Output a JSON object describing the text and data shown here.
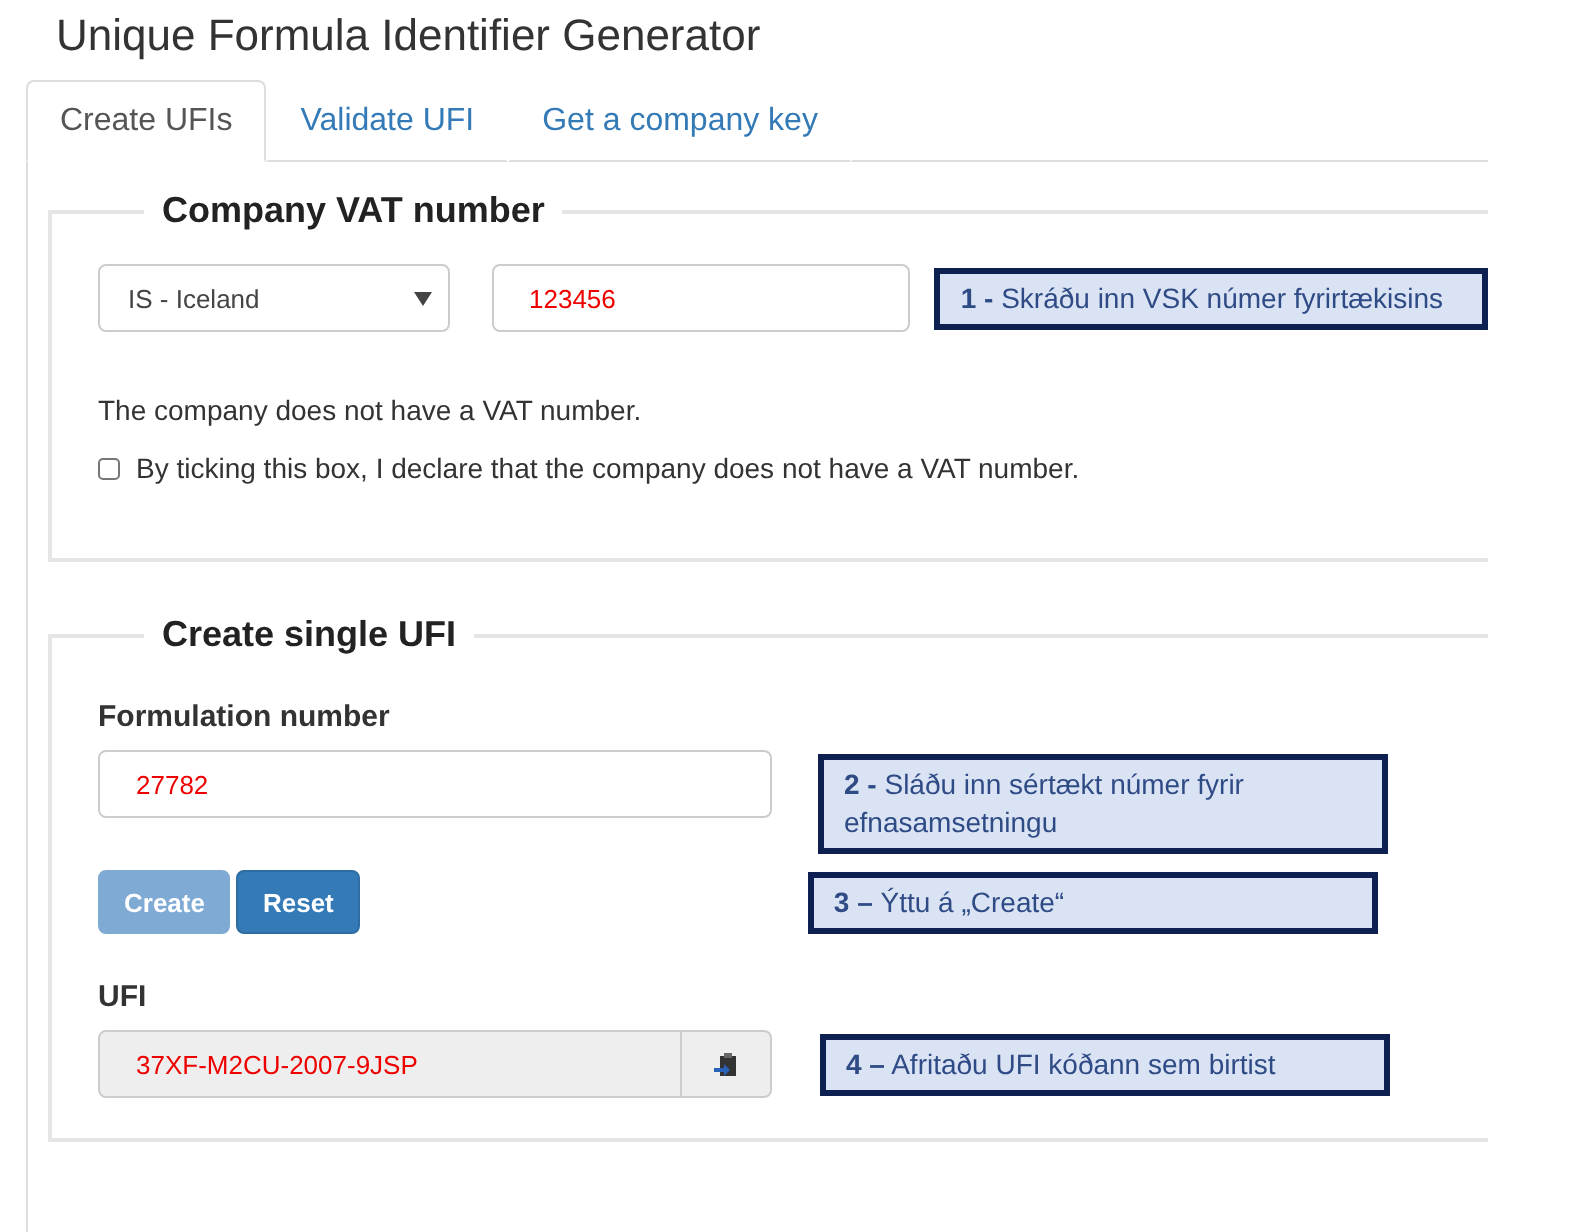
{
  "title": "Unique Formula Identifier Generator",
  "tabs": [
    {
      "label": "Create UFIs",
      "selected": true
    },
    {
      "label": "Validate UFI",
      "selected": false
    },
    {
      "label": "Get a company key",
      "selected": false
    }
  ],
  "vat_section": {
    "legend": "Company VAT number",
    "country_select": {
      "value": "IS - Iceland"
    },
    "vat_field": {
      "value": "123456"
    },
    "note": "The company does not have a VAT number.",
    "no_vat_checkbox": {
      "label": "By ticking this box, I declare that the company does not have a VAT number.",
      "checked": false
    }
  },
  "single_ufi_section": {
    "legend": "Create single UFI",
    "formulation_label": "Formulation number",
    "formulation_field": {
      "value": "27782"
    },
    "buttons": [
      {
        "label": "Create",
        "disabled": true
      },
      {
        "label": "Reset",
        "disabled": false
      }
    ],
    "ufi_label": "UFI",
    "ufi_field": {
      "value": "37XF-M2CU-2007-9JSP"
    }
  },
  "callouts": [
    {
      "text": "**1 -** Skráðu inn VSK númer fyrirtækisins"
    },
    {
      "text": "**2 -** Sláðu inn sértækt númer fyrir efnasamsetningu"
    },
    {
      "text": "**3 –** Ýttu á „Create“"
    },
    {
      "text": "**4 –** Afritaðu UFI kóðann sem birtist"
    }
  ]
}
